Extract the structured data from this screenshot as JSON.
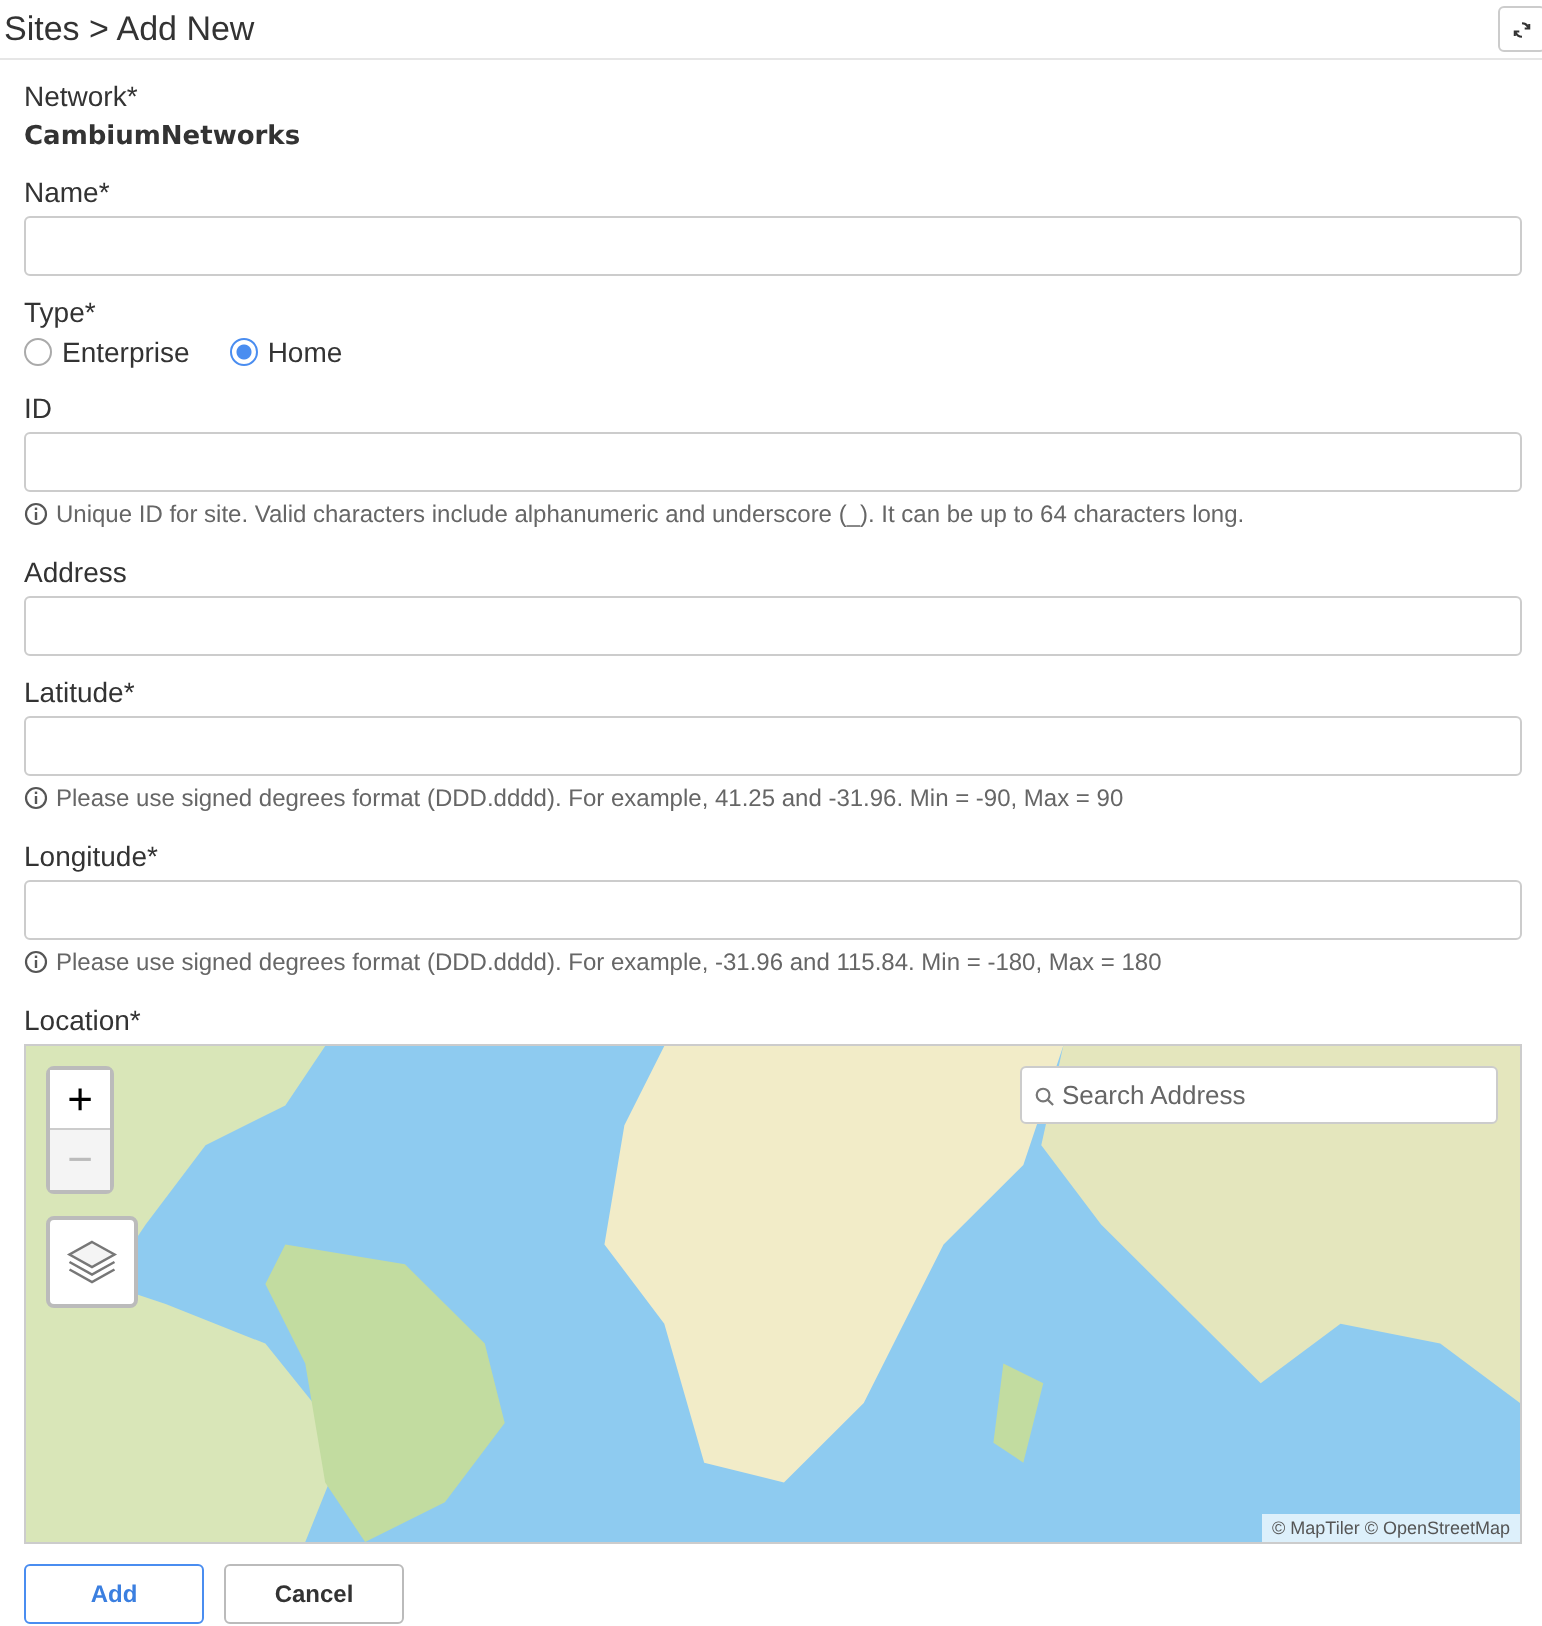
{
  "header": {
    "title": "Sites > Add New"
  },
  "fields": [
    {
      "kind": "static",
      "label": "Network*",
      "value": "CambiumNetworks"
    },
    {
      "kind": "text",
      "label": "Name*"
    },
    {
      "kind": "radio",
      "label": "Type*",
      "options": [
        {
          "label": "Enterprise",
          "selected": false
        },
        {
          "label": "Home",
          "selected": true
        }
      ]
    },
    {
      "kind": "text",
      "label": "ID",
      "help": "Unique ID for site. Valid characters include alphanumeric and underscore (_). It can be up to 64 characters long."
    },
    {
      "kind": "text",
      "label": "Address"
    },
    {
      "kind": "text",
      "label": "Latitude*",
      "help": "Please use signed degrees format (DDD.dddd). For example, 41.25 and -31.96. Min = -90, Max = 90"
    },
    {
      "kind": "text",
      "label": "Longitude*",
      "help": "Please use signed degrees format (DDD.dddd). For example, -31.96 and 115.84. Min = -180, Max = 180"
    },
    {
      "kind": "map",
      "label": "Location*",
      "zoom_in": "+",
      "zoom_out": "−",
      "search_placeholder": "Search Address",
      "attribution": "© MapTiler © OpenStreetMap"
    }
  ],
  "buttons": [
    {
      "label": "Add",
      "kind": "primary"
    },
    {
      "label": "Cancel",
      "kind": "secondary"
    }
  ]
}
